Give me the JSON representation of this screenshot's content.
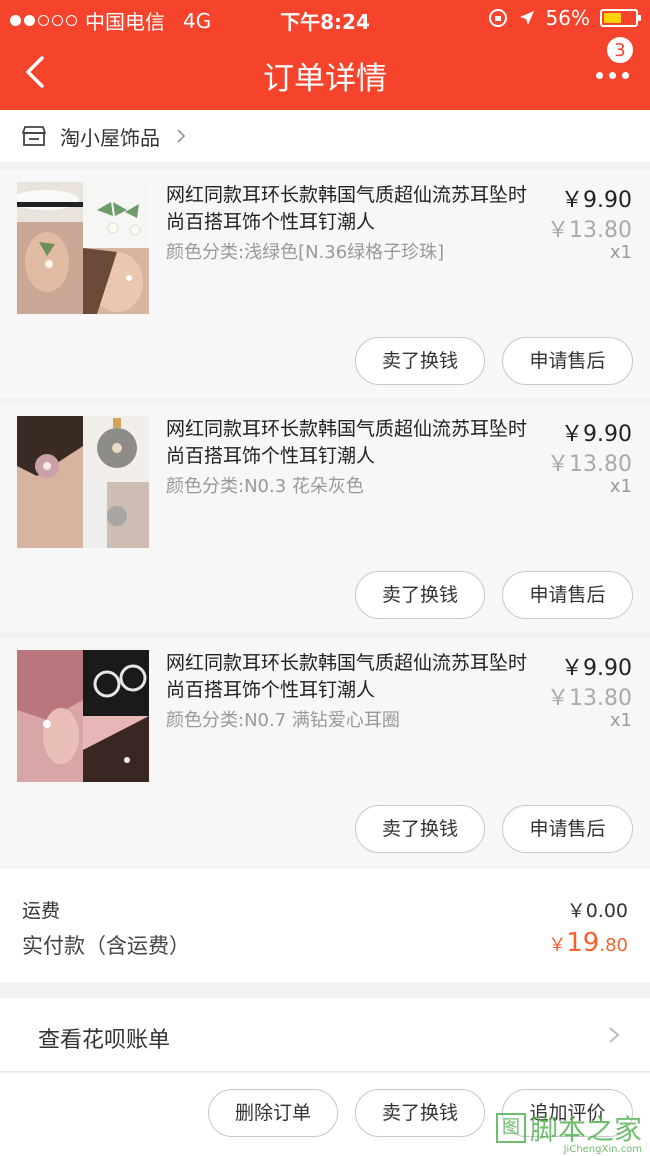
{
  "status_bar": {
    "carrier": "中国电信",
    "network": "4G",
    "time": "下午8:24",
    "battery": "56%",
    "battery_level": 0.56,
    "signal_dots_filled": 2,
    "signal_dots_total": 5
  },
  "nav": {
    "title": "订单详情",
    "badge_count": "3"
  },
  "shop": {
    "name": "淘小屋饰品"
  },
  "items": [
    {
      "title": "网红同款耳环长款韩国气质超仙流苏耳坠时尚百搭耳饰个性耳钉潮人",
      "sku": "颜色分类:浅绿色[N.36绿格子珍珠]",
      "price": "￥9.90",
      "original_price": "￥13.80",
      "quantity": "x1",
      "sell_label": "卖了换钱",
      "after_sale_label": "申请售后"
    },
    {
      "title": "网红同款耳环长款韩国气质超仙流苏耳坠时尚百搭耳饰个性耳钉潮人",
      "sku": "颜色分类:N0.3 花朵灰色",
      "price": "￥9.90",
      "original_price": "￥13.80",
      "quantity": "x1",
      "sell_label": "卖了换钱",
      "after_sale_label": "申请售后"
    },
    {
      "title": "网红同款耳环长款韩国气质超仙流苏耳坠时尚百搭耳饰个性耳钉潮人",
      "sku": "颜色分类:N0.7 满钻爱心耳圈",
      "price": "￥9.90",
      "original_price": "￥13.80",
      "quantity": "x1",
      "sell_label": "卖了换钱",
      "after_sale_label": "申请售后"
    }
  ],
  "fees": {
    "shipping_label": "运费",
    "shipping_value": "￥0.00",
    "paid_label": "实付款（含运费）",
    "paid_currency": "￥",
    "paid_int": "19",
    "paid_dec": ".80"
  },
  "huabei": {
    "label": "查看花呗账单"
  },
  "footer": {
    "delete_label": "删除订单",
    "sell_label": "卖了换钱",
    "review_label": "追加评价"
  },
  "watermark": {
    "box_text": "图",
    "text": "脚本之家",
    "url": "JiChengXin.com"
  },
  "colors": {
    "brand": "#f5432c",
    "price_accent": "#f5622c",
    "battery": "#ffd200"
  }
}
